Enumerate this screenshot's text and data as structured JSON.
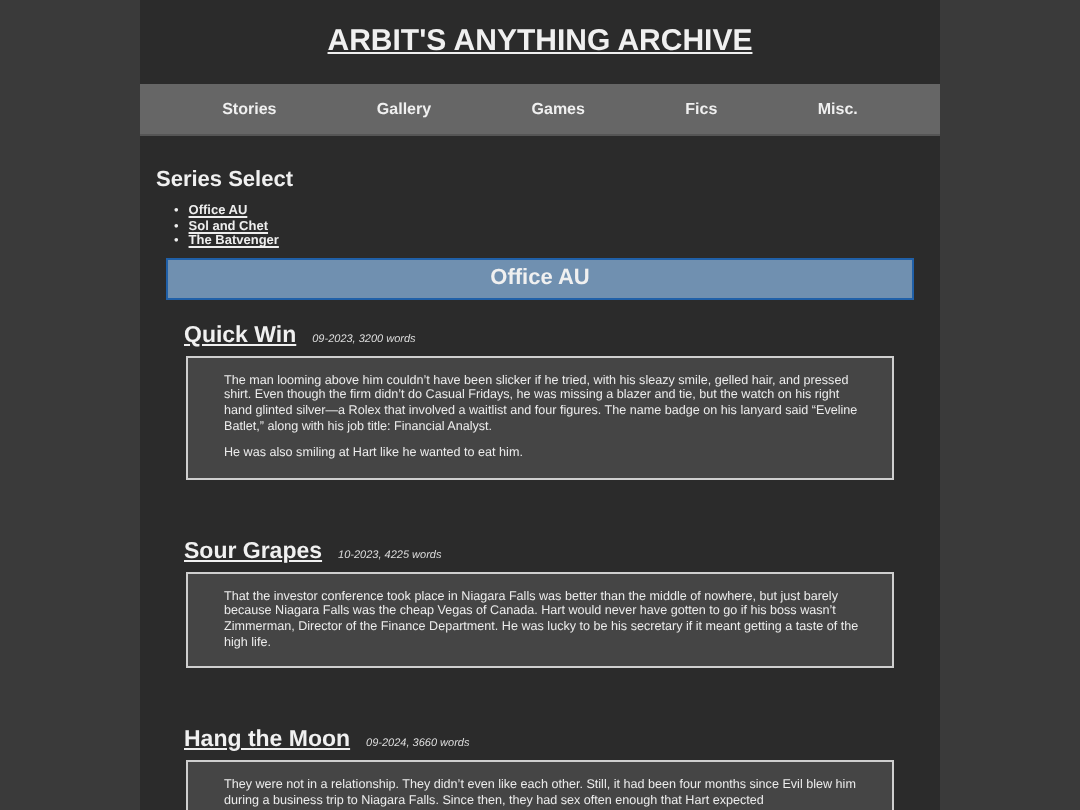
{
  "site_title": "ARBIT'S ANYTHING ARCHIVE",
  "nav": [
    {
      "label": "Stories"
    },
    {
      "label": "Gallery"
    },
    {
      "label": "Games"
    },
    {
      "label": "Fics"
    },
    {
      "label": "Misc."
    }
  ],
  "series_select": {
    "heading": "Series Select",
    "links": [
      {
        "bullet": "•",
        "label": "Office AU"
      },
      {
        "bullet": "•",
        "label": "Sol and Chet"
      },
      {
        "bullet": "•",
        "label": "The Batvenger"
      }
    ]
  },
  "section_banner": "Office AU",
  "stories": [
    {
      "title": "Quick Win",
      "meta": "09-2023, 3200 words",
      "paragraphs": [
        "The man looming above him couldn’t have been slicker if he tried, with his sleazy smile, gelled hair, and pressed shirt. Even though the firm didn’t do Casual Fridays, he was missing a blazer and tie, but the watch on his right hand glinted silver—a Rolex that involved a waitlist and four figures. The name badge on his lanyard said “Eveline Batlet,” along with his job title: Financial Analyst.",
        "He was also smiling at Hart like he wanted to eat him."
      ]
    },
    {
      "title": "Sour Grapes",
      "meta": "10-2023, 4225 words",
      "paragraphs": [
        "That the investor conference took place in Niagara Falls was better than the middle of nowhere, but just barely because Niagara Falls was the cheap Vegas of Canada. Hart would never have gotten to go if his boss wasn’t Zimmerman, Director of the Finance Department. He was lucky to be his secretary if it meant getting a taste of the high life."
      ]
    },
    {
      "title": "Hang the Moon",
      "meta": "09-2024, 3660 words",
      "paragraphs": [
        "They were not in a relationship. They didn’t even like each other. Still, it had been four months since Evil blew him during a business trip to Niagara Falls. Since then, they had sex often enough that Hart expected"
      ]
    }
  ]
}
